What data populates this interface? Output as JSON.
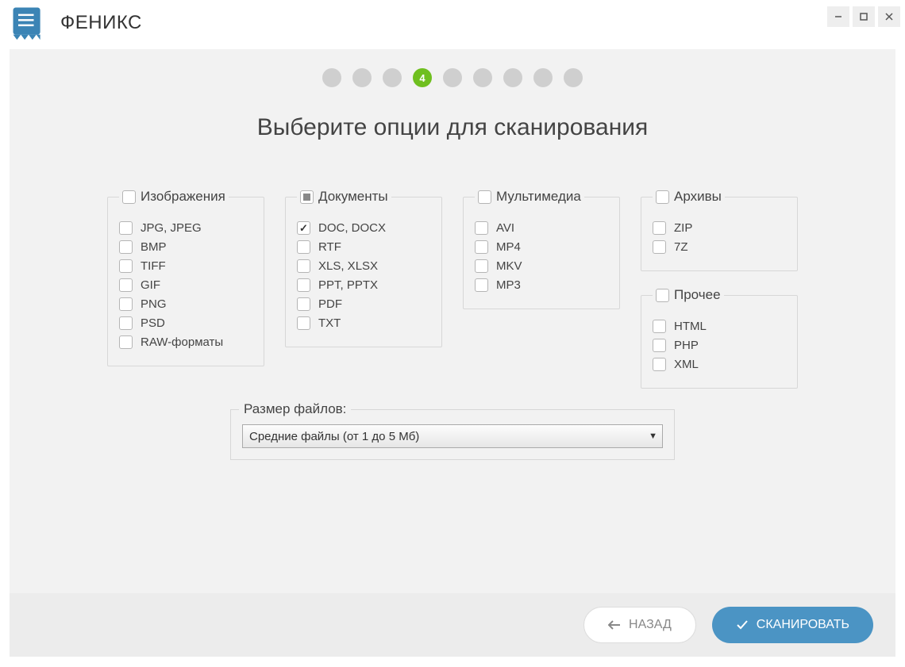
{
  "app": {
    "title": "ФЕНИКС"
  },
  "stepper": {
    "total": 9,
    "current": 4,
    "current_label": "4"
  },
  "heading": "Выберите опции для сканирования",
  "groups": {
    "images": {
      "title": "Изображения",
      "header_state": "unchecked",
      "items": [
        {
          "label": "JPG, JPEG",
          "checked": false
        },
        {
          "label": "BMP",
          "checked": false
        },
        {
          "label": "TIFF",
          "checked": false
        },
        {
          "label": "GIF",
          "checked": false
        },
        {
          "label": "PNG",
          "checked": false
        },
        {
          "label": "PSD",
          "checked": false
        },
        {
          "label": "RAW-форматы",
          "checked": false
        }
      ]
    },
    "documents": {
      "title": "Документы",
      "header_state": "indeterminate",
      "items": [
        {
          "label": "DOC, DOCX",
          "checked": true
        },
        {
          "label": "RTF",
          "checked": false
        },
        {
          "label": "XLS, XLSX",
          "checked": false
        },
        {
          "label": "PPT, PPTX",
          "checked": false
        },
        {
          "label": "PDF",
          "checked": false
        },
        {
          "label": "TXT",
          "checked": false
        }
      ]
    },
    "multimedia": {
      "title": "Мультимедиа",
      "header_state": "unchecked",
      "items": [
        {
          "label": "AVI",
          "checked": false
        },
        {
          "label": "MP4",
          "checked": false
        },
        {
          "label": "MKV",
          "checked": false
        },
        {
          "label": "MP3",
          "checked": false
        }
      ]
    },
    "archives": {
      "title": "Архивы",
      "header_state": "unchecked",
      "items": [
        {
          "label": "ZIP",
          "checked": false
        },
        {
          "label": "7Z",
          "checked": false
        }
      ]
    },
    "other": {
      "title": "Прочее",
      "header_state": "unchecked",
      "items": [
        {
          "label": "HTML",
          "checked": false
        },
        {
          "label": "PHP",
          "checked": false
        },
        {
          "label": "XML",
          "checked": false
        }
      ]
    }
  },
  "filesize": {
    "label": "Размер файлов:",
    "selected": "Средние файлы (от 1 до 5 Мб)"
  },
  "buttons": {
    "back": "НАЗАД",
    "scan": "СКАНИРОВАТЬ"
  }
}
